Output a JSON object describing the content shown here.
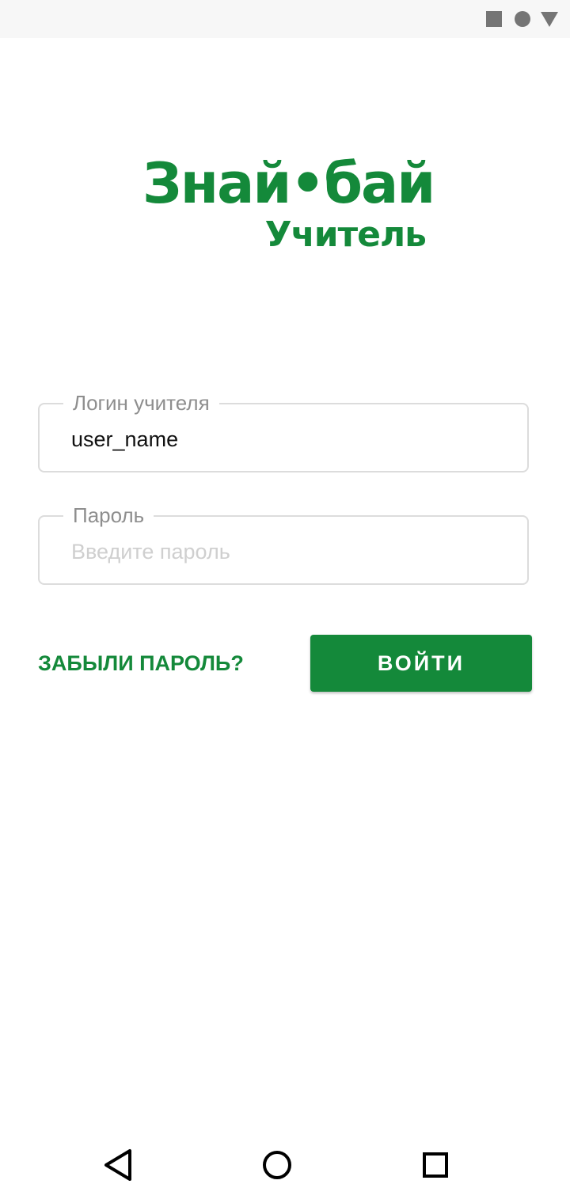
{
  "app": {
    "logo_main": "Знай•бай",
    "logo_sub": "Учитель",
    "accent_color": "#14893a"
  },
  "status_bar": {
    "icons": [
      "square-icon",
      "circle-icon",
      "triangle-icon"
    ]
  },
  "login_field": {
    "label": "Логин учителя",
    "value": "user_name"
  },
  "password_field": {
    "label": "Пароль",
    "placeholder": "Введите пароль",
    "value": ""
  },
  "actions": {
    "forgot_password": "ЗАБЫЛИ ПАРОЛЬ?",
    "login": "ВОЙТИ"
  },
  "nav_bar": {
    "icons": [
      "back-icon",
      "home-icon",
      "recents-icon"
    ]
  }
}
